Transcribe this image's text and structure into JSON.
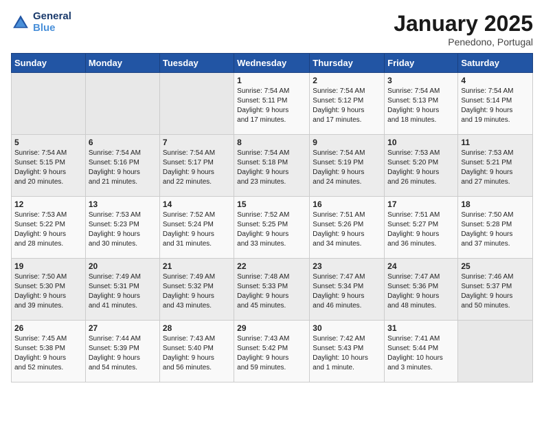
{
  "header": {
    "logo_line1": "General",
    "logo_line2": "Blue",
    "month": "January 2025",
    "location": "Penedono, Portugal"
  },
  "weekdays": [
    "Sunday",
    "Monday",
    "Tuesday",
    "Wednesday",
    "Thursday",
    "Friday",
    "Saturday"
  ],
  "weeks": [
    [
      {
        "day": "",
        "info": ""
      },
      {
        "day": "",
        "info": ""
      },
      {
        "day": "",
        "info": ""
      },
      {
        "day": "1",
        "info": "Sunrise: 7:54 AM\nSunset: 5:11 PM\nDaylight: 9 hours\nand 17 minutes."
      },
      {
        "day": "2",
        "info": "Sunrise: 7:54 AM\nSunset: 5:12 PM\nDaylight: 9 hours\nand 17 minutes."
      },
      {
        "day": "3",
        "info": "Sunrise: 7:54 AM\nSunset: 5:13 PM\nDaylight: 9 hours\nand 18 minutes."
      },
      {
        "day": "4",
        "info": "Sunrise: 7:54 AM\nSunset: 5:14 PM\nDaylight: 9 hours\nand 19 minutes."
      }
    ],
    [
      {
        "day": "5",
        "info": "Sunrise: 7:54 AM\nSunset: 5:15 PM\nDaylight: 9 hours\nand 20 minutes."
      },
      {
        "day": "6",
        "info": "Sunrise: 7:54 AM\nSunset: 5:16 PM\nDaylight: 9 hours\nand 21 minutes."
      },
      {
        "day": "7",
        "info": "Sunrise: 7:54 AM\nSunset: 5:17 PM\nDaylight: 9 hours\nand 22 minutes."
      },
      {
        "day": "8",
        "info": "Sunrise: 7:54 AM\nSunset: 5:18 PM\nDaylight: 9 hours\nand 23 minutes."
      },
      {
        "day": "9",
        "info": "Sunrise: 7:54 AM\nSunset: 5:19 PM\nDaylight: 9 hours\nand 24 minutes."
      },
      {
        "day": "10",
        "info": "Sunrise: 7:53 AM\nSunset: 5:20 PM\nDaylight: 9 hours\nand 26 minutes."
      },
      {
        "day": "11",
        "info": "Sunrise: 7:53 AM\nSunset: 5:21 PM\nDaylight: 9 hours\nand 27 minutes."
      }
    ],
    [
      {
        "day": "12",
        "info": "Sunrise: 7:53 AM\nSunset: 5:22 PM\nDaylight: 9 hours\nand 28 minutes."
      },
      {
        "day": "13",
        "info": "Sunrise: 7:53 AM\nSunset: 5:23 PM\nDaylight: 9 hours\nand 30 minutes."
      },
      {
        "day": "14",
        "info": "Sunrise: 7:52 AM\nSunset: 5:24 PM\nDaylight: 9 hours\nand 31 minutes."
      },
      {
        "day": "15",
        "info": "Sunrise: 7:52 AM\nSunset: 5:25 PM\nDaylight: 9 hours\nand 33 minutes."
      },
      {
        "day": "16",
        "info": "Sunrise: 7:51 AM\nSunset: 5:26 PM\nDaylight: 9 hours\nand 34 minutes."
      },
      {
        "day": "17",
        "info": "Sunrise: 7:51 AM\nSunset: 5:27 PM\nDaylight: 9 hours\nand 36 minutes."
      },
      {
        "day": "18",
        "info": "Sunrise: 7:50 AM\nSunset: 5:28 PM\nDaylight: 9 hours\nand 37 minutes."
      }
    ],
    [
      {
        "day": "19",
        "info": "Sunrise: 7:50 AM\nSunset: 5:30 PM\nDaylight: 9 hours\nand 39 minutes."
      },
      {
        "day": "20",
        "info": "Sunrise: 7:49 AM\nSunset: 5:31 PM\nDaylight: 9 hours\nand 41 minutes."
      },
      {
        "day": "21",
        "info": "Sunrise: 7:49 AM\nSunset: 5:32 PM\nDaylight: 9 hours\nand 43 minutes."
      },
      {
        "day": "22",
        "info": "Sunrise: 7:48 AM\nSunset: 5:33 PM\nDaylight: 9 hours\nand 45 minutes."
      },
      {
        "day": "23",
        "info": "Sunrise: 7:47 AM\nSunset: 5:34 PM\nDaylight: 9 hours\nand 46 minutes."
      },
      {
        "day": "24",
        "info": "Sunrise: 7:47 AM\nSunset: 5:36 PM\nDaylight: 9 hours\nand 48 minutes."
      },
      {
        "day": "25",
        "info": "Sunrise: 7:46 AM\nSunset: 5:37 PM\nDaylight: 9 hours\nand 50 minutes."
      }
    ],
    [
      {
        "day": "26",
        "info": "Sunrise: 7:45 AM\nSunset: 5:38 PM\nDaylight: 9 hours\nand 52 minutes."
      },
      {
        "day": "27",
        "info": "Sunrise: 7:44 AM\nSunset: 5:39 PM\nDaylight: 9 hours\nand 54 minutes."
      },
      {
        "day": "28",
        "info": "Sunrise: 7:43 AM\nSunset: 5:40 PM\nDaylight: 9 hours\nand 56 minutes."
      },
      {
        "day": "29",
        "info": "Sunrise: 7:43 AM\nSunset: 5:42 PM\nDaylight: 9 hours\nand 59 minutes."
      },
      {
        "day": "30",
        "info": "Sunrise: 7:42 AM\nSunset: 5:43 PM\nDaylight: 10 hours\nand 1 minute."
      },
      {
        "day": "31",
        "info": "Sunrise: 7:41 AM\nSunset: 5:44 PM\nDaylight: 10 hours\nand 3 minutes."
      },
      {
        "day": "",
        "info": ""
      }
    ]
  ]
}
